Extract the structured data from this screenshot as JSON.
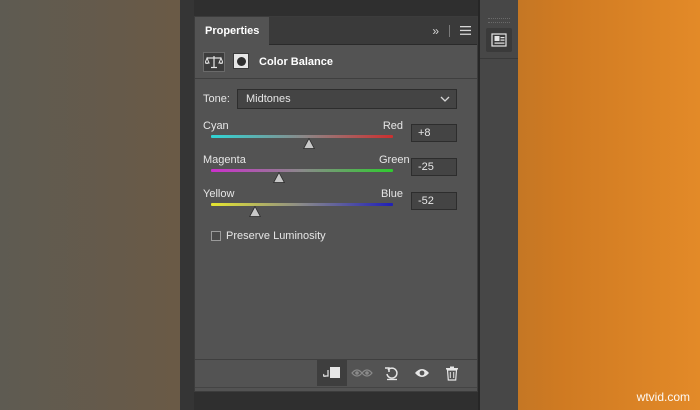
{
  "panel": {
    "tab_label": "Properties",
    "adjustment_title": "Color Balance"
  },
  "tone": {
    "label": "Tone:",
    "selected": "Midtones"
  },
  "sliders": [
    {
      "left": "Cyan",
      "right": "Red",
      "value": "+8",
      "amount": 8,
      "min": -100,
      "max": 100,
      "gradient": [
        "#2fd6d6",
        "#cc2f2f"
      ]
    },
    {
      "left": "Magenta",
      "right": "Green",
      "value": "-25",
      "amount": -25,
      "min": -100,
      "max": 100,
      "gradient": [
        "#cc2fcc",
        "#2fcc2f"
      ]
    },
    {
      "left": "Yellow",
      "right": "Blue",
      "value": "-52",
      "amount": -52,
      "min": -100,
      "max": 100,
      "gradient": [
        "#e6e62f",
        "#1f1fb8"
      ]
    }
  ],
  "preserve_luminosity": {
    "label": "Preserve Luminosity",
    "checked": false
  },
  "watermark": "wtvid.com"
}
